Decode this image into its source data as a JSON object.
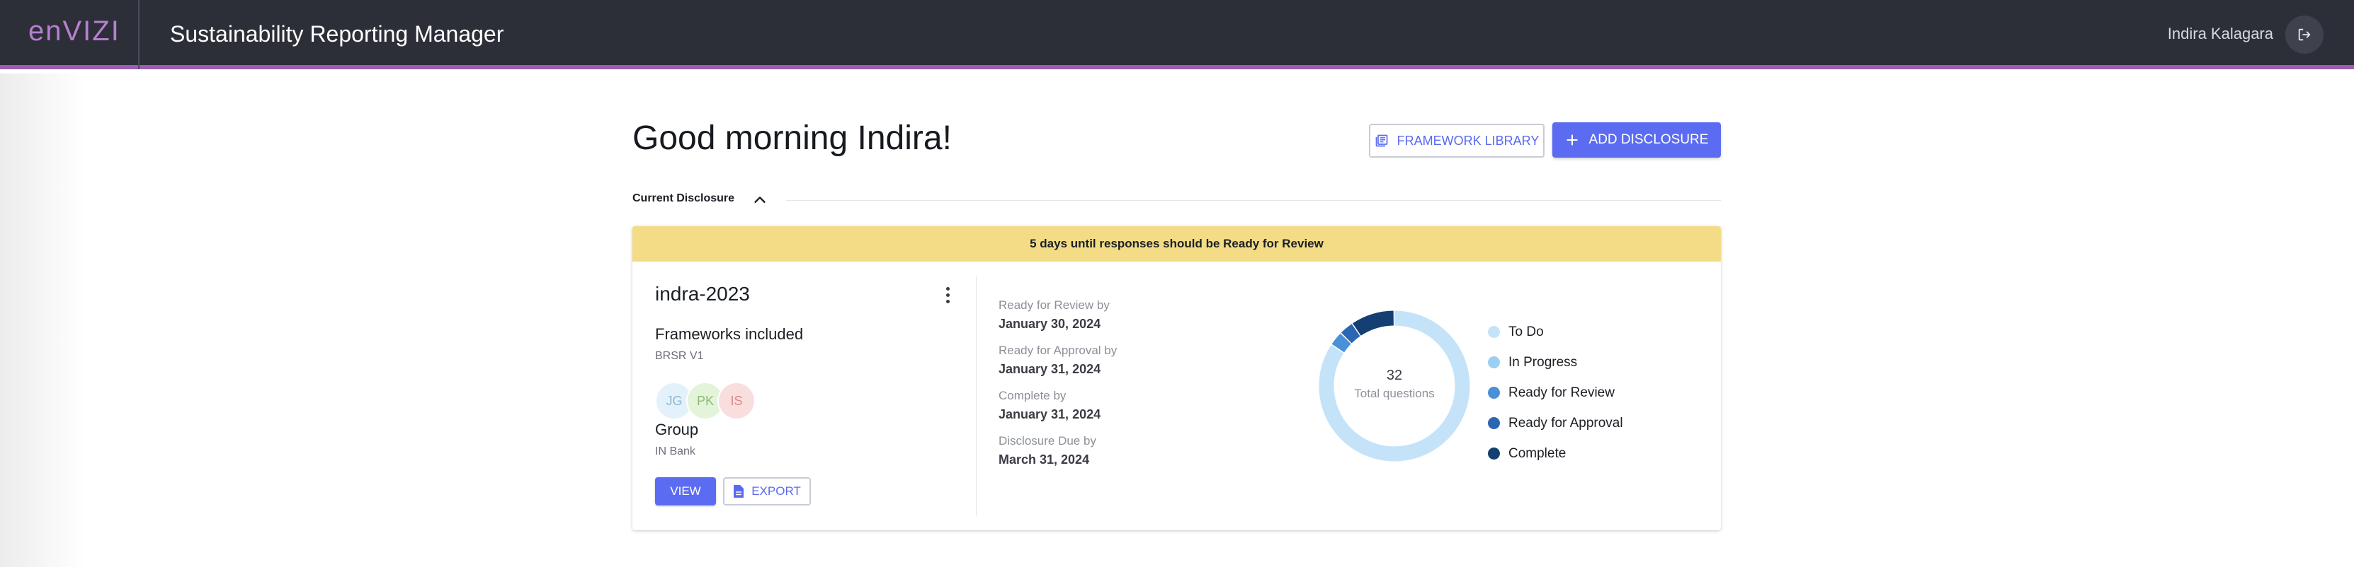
{
  "header": {
    "logo": "enVIZI",
    "app_title": "Sustainability Reporting Manager",
    "user_name": "Indira Kalagara"
  },
  "main": {
    "greeting": "Good morning Indira!",
    "framework_library_label": "FRAMEWORK LIBRARY",
    "add_disclosure_label": "ADD DISCLOSURE",
    "section_label": "Current Disclosure"
  },
  "card": {
    "banner": "5 days until responses should be Ready for Review",
    "name": "indra-2023",
    "frameworks_label": "Frameworks included",
    "frameworks_value": "BRSR V1",
    "avatars": [
      {
        "initials": "JG",
        "bg": "#e3f1fb",
        "fg": "#8fb7d3"
      },
      {
        "initials": "PK",
        "bg": "#e4f4da",
        "fg": "#8cbc72"
      },
      {
        "initials": "IS",
        "bg": "#f8dedd",
        "fg": "#d98a88"
      }
    ],
    "group_label": "Group",
    "group_value": "IN Bank",
    "view_label": "VIEW",
    "export_label": "EXPORT",
    "dates": [
      {
        "label": "Ready for Review by",
        "value": "January 30, 2024"
      },
      {
        "label": "Ready for Approval by",
        "value": "January 31, 2024"
      },
      {
        "label": "Complete by",
        "value": "January 31, 2024"
      },
      {
        "label": "Disclosure Due by",
        "value": "March 31, 2024"
      }
    ],
    "total_count": "32",
    "total_label": "Total questions",
    "status_breakdown": [
      {
        "label": "To Do",
        "color": "#c4e3f9",
        "count": 27
      },
      {
        "label": "In Progress",
        "color": "#9bcff3",
        "count": 0
      },
      {
        "label": "Ready for Review",
        "color": "#4a90d9",
        "count": 1
      },
      {
        "label": "Ready for Approval",
        "color": "#2a66b3",
        "count": 1
      },
      {
        "label": "Complete",
        "color": "#143f73",
        "count": 3
      }
    ]
  },
  "colors": {
    "accent": "#5b6cf2",
    "header_bg": "#2d2f38",
    "header_stripe": "#9b5db8",
    "banner_bg": "#f3dc85"
  }
}
